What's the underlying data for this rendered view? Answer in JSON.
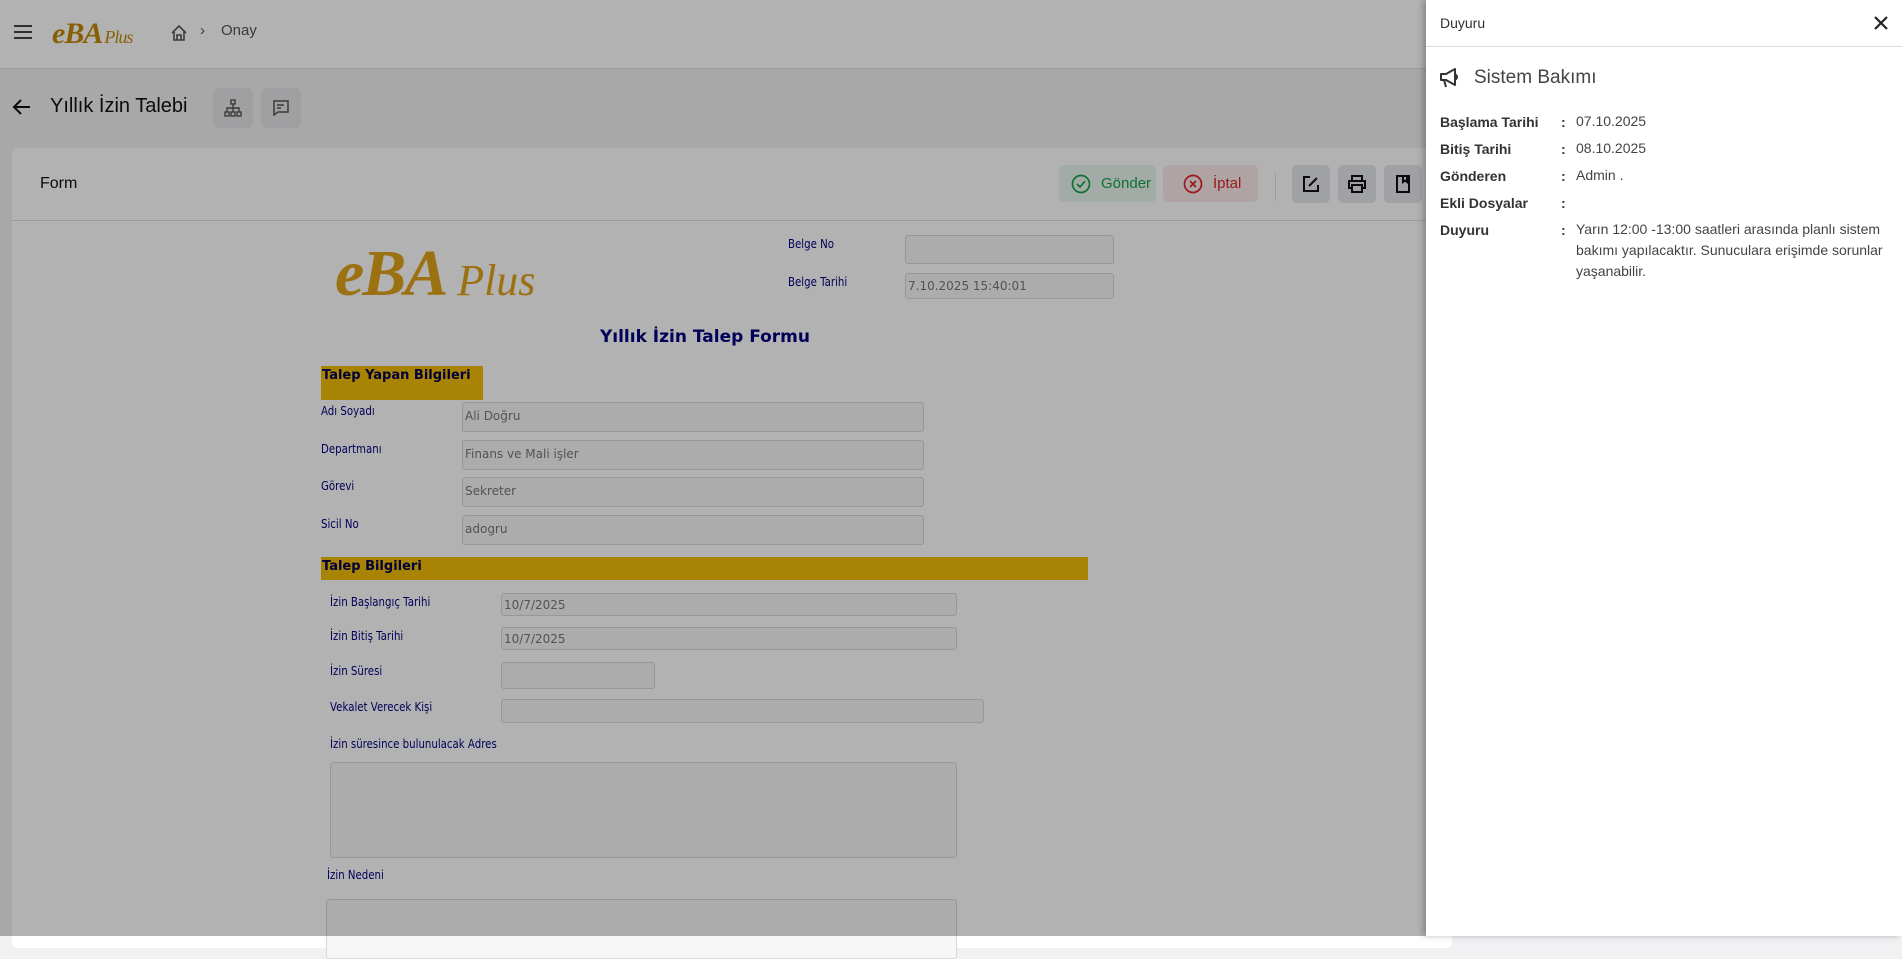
{
  "topbar": {
    "logo": "eBA",
    "logo_suffix": "Plus",
    "breadcrumb": "Onay"
  },
  "page": {
    "title": "Yıllık İzin Talebi"
  },
  "card": {
    "title": "Form",
    "send": "Gönder",
    "cancel": "İptal"
  },
  "form": {
    "belge_no_label": "Belge No",
    "belge_no": "",
    "belge_tarihi_label": "Belge Tarihi",
    "belge_tarihi": "7.10.2025 15:40:01",
    "title": "Yıllık İzin Talep Formu",
    "section1": "Talep Yapan Bilgileri",
    "fields1": [
      {
        "label": "Adı Soyadı",
        "value": "Ali Doğru"
      },
      {
        "label": "Departmanı",
        "value": "Finans ve Mali işler"
      },
      {
        "label": "Görevi",
        "value": "Sekreter"
      },
      {
        "label": "Sicil No",
        "value": "adogru"
      }
    ],
    "section2": "Talep Bilgileri",
    "fields2": [
      {
        "label": "İzin Başlangıç Tarihi",
        "value": "10/7/2025"
      },
      {
        "label": "İzin Bitiş Tarihi",
        "value": "10/7/2025"
      },
      {
        "label": "İzin Süresi",
        "value": ""
      },
      {
        "label": "Vekalet Verecek Kişi",
        "value": ""
      }
    ],
    "address_label": "İzin süresince bulunulacak Adres",
    "reason_label": "İzin Nedeni"
  },
  "panel": {
    "title": "Duyuru",
    "heading": "Sistem Bakımı",
    "rows": [
      {
        "label": "Başlama Tarihi",
        "value": "07.10.2025"
      },
      {
        "label": "Bitiş Tarihi",
        "value": "08.10.2025"
      },
      {
        "label": "Gönderen",
        "value": "Admin ."
      },
      {
        "label": "Ekli Dosyalar",
        "value": ""
      },
      {
        "label": "Duyuru",
        "value": "Yarın 12:00 -13:00 saatleri arasında planlı sistem bakımı yapılacaktır. Sunuculara erişimde sorunlar yaşanabilir."
      }
    ]
  },
  "colors": {
    "brand": "#c28a0a",
    "section": "#f3be07",
    "send": "#16a34a",
    "cancel": "#dc2626"
  }
}
